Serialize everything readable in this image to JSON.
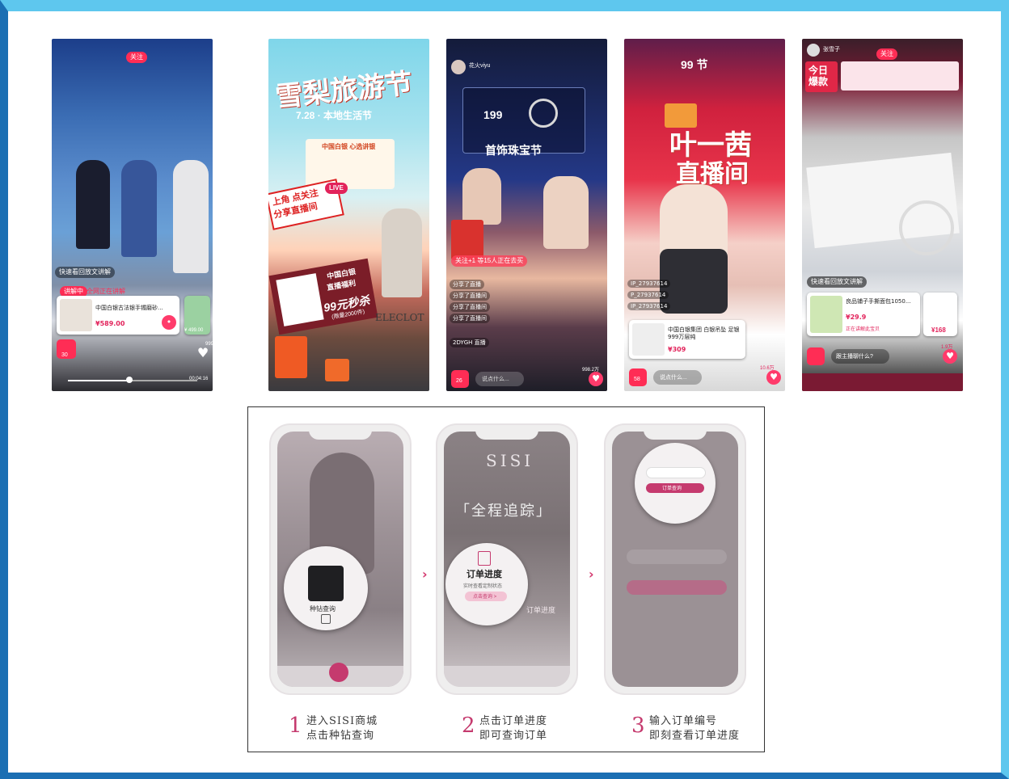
{
  "colors": {
    "frame_light": "#5ec7ee",
    "frame_dark": "#1b6fb3",
    "accent": "#ff3b6b",
    "step_accent": "#c53a6e"
  },
  "screenshots": [
    {
      "follow": "关注",
      "live_banner": "讲解中",
      "banner_sub": "全网正在讲解",
      "product_title": "中国白银古法银手镯磨砂...",
      "price": "¥589.00",
      "side_price": "¥ 499.00",
      "likes": "999.6万",
      "bag_count": "30",
      "time": "00:04:16",
      "quick": "快速看回放文讲解"
    },
    {
      "headline": "雪梨旅游节",
      "date_line": "7.28 · 本地生活节",
      "box_title": "中国白银 心选讲银",
      "sign_1": "上角 点关注",
      "sign_2": "分享直播间",
      "live_tag": "LIVE",
      "card_title": "中国白银",
      "card_sub": "直播福利",
      "sale": "99元秒杀",
      "sale_sub": "(限量2000件)",
      "brand": "ELECLOT"
    },
    {
      "host": "花火viyu",
      "price_tag": "199",
      "festival": "首饰珠宝节",
      "viewers": "关注+1 等15人正在去买",
      "chat": [
        "分享了直播",
        "分享了直播间",
        "分享了直播间",
        "分享了直播间",
        "2DYGH 直播"
      ],
      "bag_count": "26",
      "bottom_input": "说点什么...",
      "likes": "998.2万"
    },
    {
      "festival_tag": "99 节",
      "big_1": "叶一茜",
      "big_2": "直播间",
      "chat": [
        "IP_27937614",
        "P_27937614",
        "IP_27937614"
      ],
      "card_title": "中国白银集团 白银吊坠 足银999万层纯",
      "card_price": "¥309",
      "bag_count": "58",
      "bottom_input": "说点什么...",
      "likes": "10.6万"
    },
    {
      "host": "张雪子",
      "follow": "关注",
      "today": "今日爆款",
      "quick": "快速看回放文讲解",
      "card_title": "良品铺子手撕面包1050...",
      "card_price": "¥29.9",
      "card_sub": "正在讲解此宝贝",
      "side_price": "¥168",
      "bottom_input": "跟主播聊什么?",
      "likes": "1.9万"
    }
  ],
  "steps": [
    {
      "num": "1",
      "line1": "进入SISI商城",
      "line2": "点击种钻查询"
    },
    {
      "num": "2",
      "line1": "点击订单进度",
      "line2": "即可查询订单"
    },
    {
      "num": "3",
      "line1": "输入订单编号",
      "line2": "即刻查看订单进度"
    }
  ],
  "phones": [
    {
      "bubble_label": "种钻查询"
    },
    {
      "logo": "SISI",
      "headline": "「全程追踪」",
      "bubble_title": "订单进度",
      "bubble_sub": "实时查看定制状态",
      "bubble_btn": "点击查询 >",
      "side_label": "订单进度"
    },
    {
      "button": "订单查询"
    }
  ]
}
